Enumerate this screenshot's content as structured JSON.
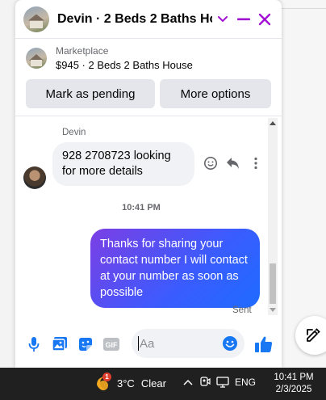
{
  "chat": {
    "title": "Devin · 2 Beds 2 Baths Ho…",
    "listing": {
      "label": "Marketplace",
      "summary": "$945 · 2 Beds 2 Baths House"
    },
    "actions": {
      "mark_pending": "Mark as pending",
      "more_options": "More options"
    },
    "messages": {
      "sender_name": "Devin",
      "incoming_text": "928 2708723 looking for more details",
      "timestamp": "10:41 PM",
      "outgoing_text": "Thanks for sharing your contact number I will contact at your number as soon as possible",
      "status": "Sent"
    },
    "composer": {
      "placeholder": "Aa",
      "gif_label": "GIF"
    },
    "accent_color": "#a112d3"
  },
  "taskbar": {
    "weather": {
      "badge": "1",
      "temperature": "3°C",
      "condition": "Clear"
    },
    "language": "ENG",
    "time": "10:41 PM",
    "date": "2/3/2025"
  }
}
